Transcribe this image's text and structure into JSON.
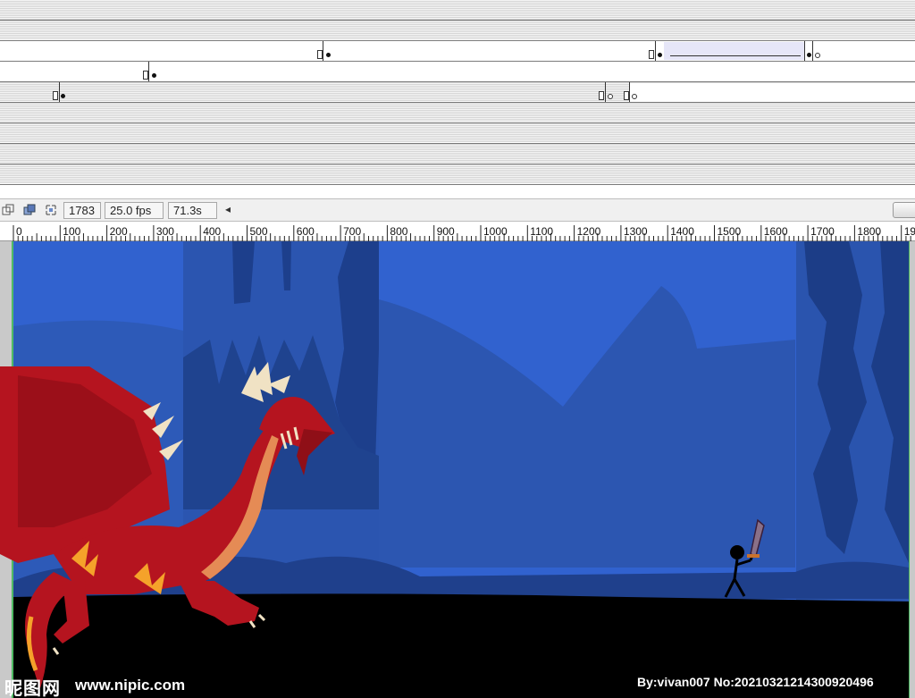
{
  "status_bar": {
    "frame": "1783",
    "fps": "25.0 fps",
    "time": "71.3s",
    "scroll_left_glyph": "◂"
  },
  "ruler": {
    "ticks": [
      "0",
      "100",
      "200",
      "300",
      "400",
      "500",
      "600",
      "700",
      "800",
      "900",
      "1000",
      "1100",
      "1200",
      "1300",
      "1400",
      "1500",
      "1600",
      "1700",
      "1800",
      "19"
    ]
  },
  "watermark": {
    "site_logo": "昵图网",
    "site_url": "www.nipic.com",
    "credit": "By:vivan007 No:20210321214300920496"
  },
  "colors": {
    "sky": "#2e63d0",
    "cave_dark": "#264d9c",
    "ground": "#000000",
    "dragon_red": "#b5141f"
  }
}
